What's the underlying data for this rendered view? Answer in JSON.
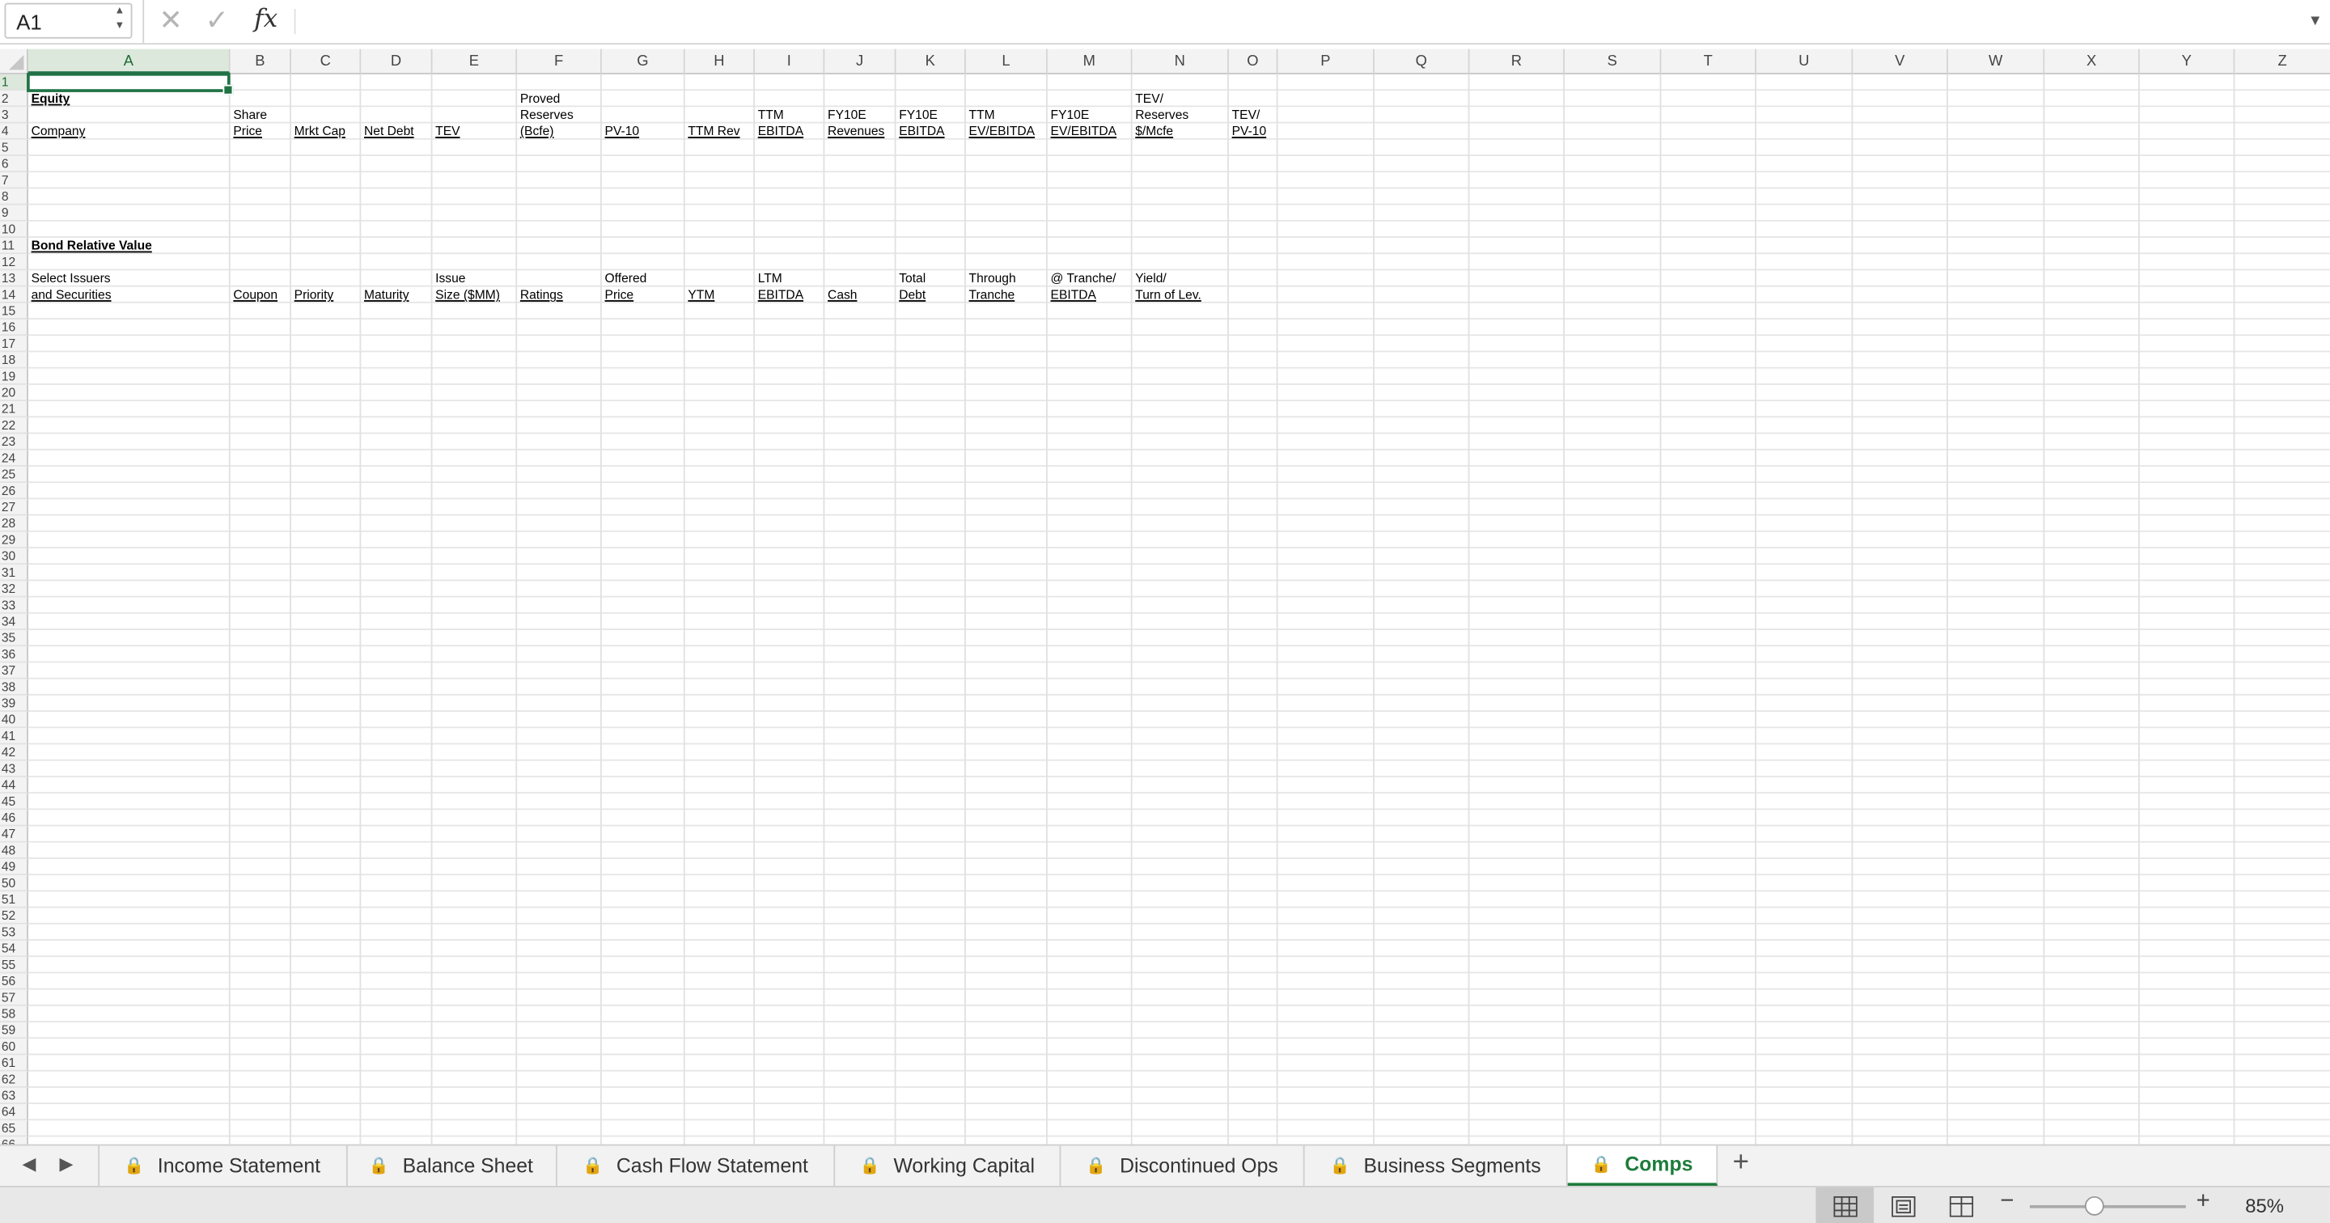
{
  "name_box": "A1",
  "formula": "",
  "zoom": "85%",
  "columns": [
    "A",
    "B",
    "C",
    "D",
    "E",
    "F",
    "G",
    "H",
    "I",
    "J",
    "K",
    "L",
    "M",
    "N",
    "O",
    "P",
    "Q",
    "R",
    "S",
    "T",
    "U",
    "V",
    "W",
    "X",
    "Y",
    "Z"
  ],
  "row_count": 66,
  "cells": [
    {
      "ref": "A2",
      "text": "Equity",
      "bold": true,
      "underline": true
    },
    {
      "ref": "F2",
      "text": "Proved"
    },
    {
      "ref": "N2",
      "text": "TEV/"
    },
    {
      "ref": "B3",
      "text": "Share"
    },
    {
      "ref": "F3",
      "text": "Reserves"
    },
    {
      "ref": "I3",
      "text": "TTM"
    },
    {
      "ref": "J3",
      "text": "FY10E"
    },
    {
      "ref": "K3",
      "text": "FY10E"
    },
    {
      "ref": "L3",
      "text": "TTM"
    },
    {
      "ref": "M3",
      "text": "FY10E"
    },
    {
      "ref": "N3",
      "text": "Reserves"
    },
    {
      "ref": "O3",
      "text": "TEV/"
    },
    {
      "ref": "A4",
      "text": "Company",
      "underline": true
    },
    {
      "ref": "B4",
      "text": "Price",
      "underline": true
    },
    {
      "ref": "C4",
      "text": "Mrkt Cap",
      "underline": true
    },
    {
      "ref": "D4",
      "text": "Net Debt",
      "underline": true
    },
    {
      "ref": "E4",
      "text": "TEV",
      "underline": true
    },
    {
      "ref": "F4",
      "text": "(Bcfe)",
      "underline": true
    },
    {
      "ref": "G4",
      "text": "PV-10",
      "underline": true
    },
    {
      "ref": "H4",
      "text": "TTM Rev",
      "underline": true
    },
    {
      "ref": "I4",
      "text": "EBITDA",
      "underline": true
    },
    {
      "ref": "J4",
      "text": "Revenues",
      "underline": true
    },
    {
      "ref": "K4",
      "text": "EBITDA",
      "underline": true
    },
    {
      "ref": "L4",
      "text": "EV/EBITDA",
      "underline": true
    },
    {
      "ref": "M4",
      "text": "EV/EBITDA",
      "underline": true
    },
    {
      "ref": "N4",
      "text": "$/Mcfe",
      "underline": true
    },
    {
      "ref": "O4",
      "text": "PV-10",
      "underline": true
    },
    {
      "ref": "A11",
      "text": "Bond Relative Value",
      "bold": true,
      "underline": true
    },
    {
      "ref": "A13",
      "text": "Select Issuers"
    },
    {
      "ref": "E13",
      "text": "Issue"
    },
    {
      "ref": "G13",
      "text": "Offered"
    },
    {
      "ref": "I13",
      "text": "LTM"
    },
    {
      "ref": "K13",
      "text": "Total"
    },
    {
      "ref": "L13",
      "text": "Through"
    },
    {
      "ref": "M13",
      "text": "@ Tranche/"
    },
    {
      "ref": "N13",
      "text": "Yield/"
    },
    {
      "ref": "A14",
      "text": "and Securities",
      "underline": true
    },
    {
      "ref": "B14",
      "text": "Coupon",
      "underline": true
    },
    {
      "ref": "C14",
      "text": "Priority",
      "underline": true
    },
    {
      "ref": "D14",
      "text": "Maturity",
      "underline": true
    },
    {
      "ref": "E14",
      "text": "Size ($MM)",
      "underline": true
    },
    {
      "ref": "F14",
      "text": "Ratings",
      "underline": true
    },
    {
      "ref": "G14",
      "text": "Price",
      "underline": true
    },
    {
      "ref": "H14",
      "text": "YTM",
      "underline": true
    },
    {
      "ref": "I14",
      "text": "EBITDA",
      "underline": true
    },
    {
      "ref": "J14",
      "text": "Cash",
      "underline": true
    },
    {
      "ref": "K14",
      "text": "Debt",
      "underline": true
    },
    {
      "ref": "L14",
      "text": "Tranche",
      "underline": true
    },
    {
      "ref": "M14",
      "text": "EBITDA",
      "underline": true
    },
    {
      "ref": "N14",
      "text": "Turn of Lev.",
      "underline": true
    }
  ],
  "sheet_tabs": [
    {
      "label": "Income Statement",
      "locked": true,
      "active": false
    },
    {
      "label": "Balance Sheet",
      "locked": true,
      "active": false
    },
    {
      "label": "Cash Flow Statement",
      "locked": true,
      "active": false
    },
    {
      "label": "Working Capital",
      "locked": true,
      "active": false
    },
    {
      "label": "Discontinued Ops",
      "locked": true,
      "active": false
    },
    {
      "label": "Business Segments",
      "locked": true,
      "active": false
    },
    {
      "label": "Comps",
      "locked": true,
      "active": true
    }
  ],
  "add_sheet_label": "+",
  "icons": {
    "cancel": "close-icon",
    "confirm": "check-icon",
    "function": "fx-icon",
    "lock": "lock-icon"
  },
  "accent_color": "#217346"
}
